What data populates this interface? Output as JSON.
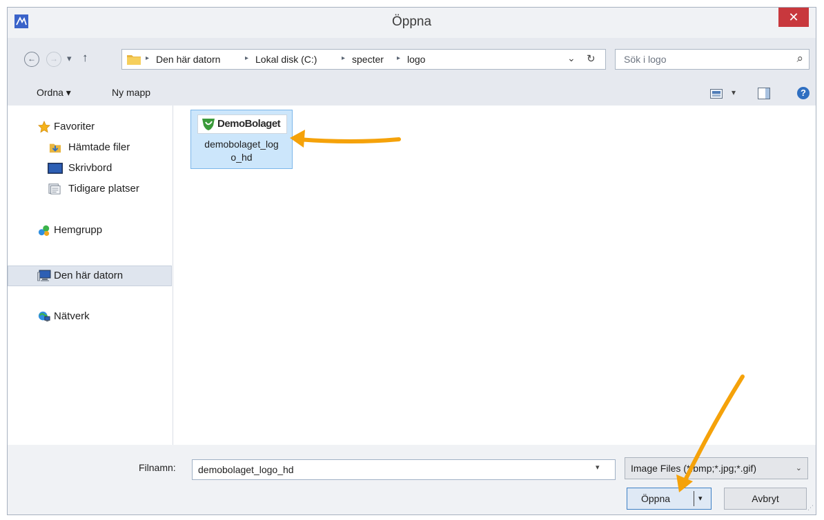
{
  "window": {
    "title": "Öppna",
    "close_glyph": "✕"
  },
  "nav": {
    "back_glyph": "←",
    "forward_glyph": "→",
    "recent_glyph": "▾",
    "up_glyph": "↑",
    "breadcrumb": [
      "Den här datorn",
      "Lokal disk (C:)",
      "specter",
      "logo"
    ],
    "address_dropdown_glyph": "⌄",
    "refresh_glyph": "↻",
    "search_placeholder": "Sök i logo",
    "search_icon_glyph": "⌕"
  },
  "toolbar": {
    "organize_label": "Ordna ▾",
    "new_folder_label": "Ny mapp",
    "view_dropdown_glyph": "▾",
    "help_glyph": "?"
  },
  "sidebar": {
    "items": [
      {
        "label": "Favoriter",
        "icon": "star-icon"
      },
      {
        "label": "Hämtade filer",
        "icon": "downloads-folder-icon"
      },
      {
        "label": "Skrivbord",
        "icon": "desktop-icon"
      },
      {
        "label": "Tidigare platser",
        "icon": "recent-places-icon"
      },
      {
        "label": "Hemgrupp",
        "icon": "homegroup-icon"
      },
      {
        "label": "Den här datorn",
        "icon": "computer-icon",
        "selected": true
      },
      {
        "label": "Nätverk",
        "icon": "network-icon"
      }
    ]
  },
  "files": [
    {
      "name": "demobolaget_log o_hd",
      "thumbnail_text": "DemoBolaget",
      "selected": true
    }
  ],
  "bottom": {
    "filename_label": "Filnamn:",
    "filename_value": "demobolaget_logo_hd",
    "filetype_value": "Image Files (*.bmp;*.jpg;*.gif)",
    "open_label": "Öppna",
    "cancel_label": "Avbryt"
  },
  "colors": {
    "close_button": "#c8383d",
    "selection": "#cce6fb",
    "annotation_arrow": "#f5a20a"
  }
}
